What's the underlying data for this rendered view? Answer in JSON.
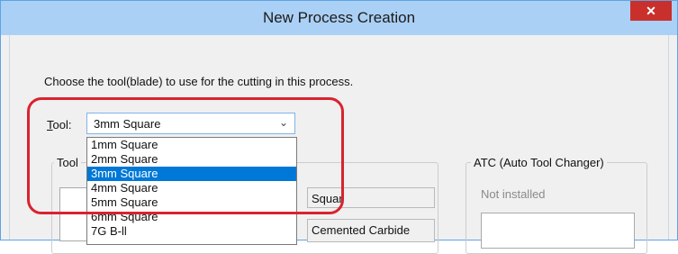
{
  "window": {
    "title": "New Process Creation",
    "close_symbol": "✕"
  },
  "instruction": "Choose the tool(blade) to use for the cutting in this process.",
  "tool": {
    "label_underlined": "T",
    "label_rest": "ool:",
    "selected": "3mm Square",
    "dropdown_arrow": "⌄",
    "options": [
      "1mm Square",
      "2mm Square",
      "3mm Square",
      "4mm Square",
      "5mm Square",
      "6mm Square",
      "7G B-ll"
    ],
    "selected_index": 2
  },
  "tool_group": {
    "label": "Tool",
    "type_value": "Squar",
    "material_value": "Cemented Carbide"
  },
  "atc": {
    "label": "ATC (Auto Tool Changer)",
    "status": "Not installed"
  },
  "colors": {
    "titlebar": "#abd0f5",
    "close": "#c9302c",
    "selection": "#0078d7",
    "highlight": "#d9232f"
  }
}
